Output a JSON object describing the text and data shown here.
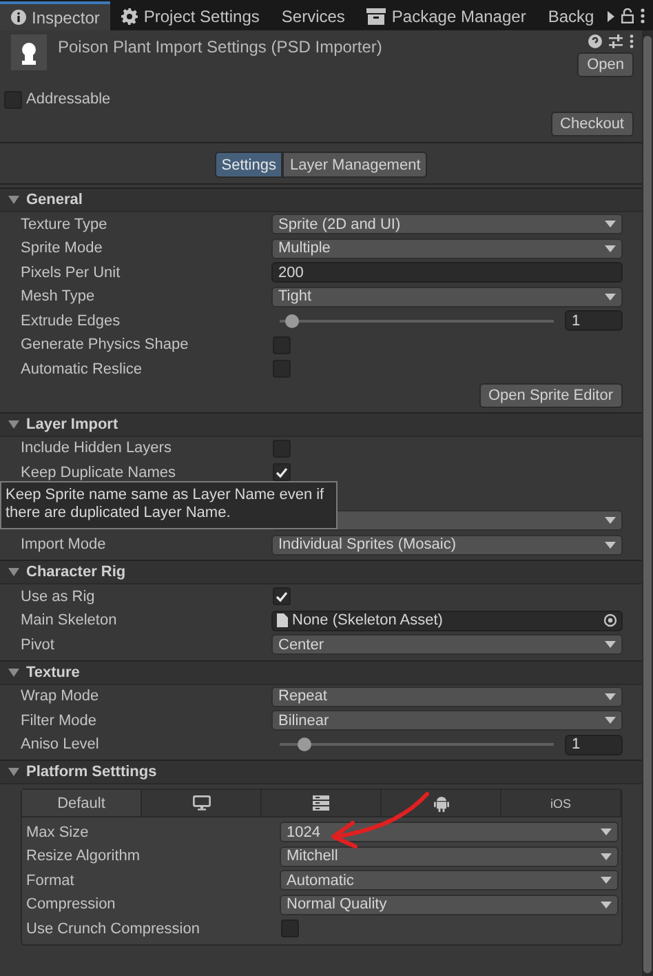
{
  "window_tabs": [
    {
      "label": "Inspector",
      "selected": true
    },
    {
      "label": "Project Settings",
      "selected": false
    },
    {
      "label": "Services",
      "selected": false
    },
    {
      "label": "Package Manager",
      "selected": false
    },
    {
      "label": "Backg",
      "selected": false
    }
  ],
  "header": {
    "title": "Poison Plant Import Settings (PSD Importer)",
    "open_button": "Open",
    "addressable": {
      "label": "Addressable",
      "checked": false
    },
    "checkout_button": "Checkout"
  },
  "mode_tabs": [
    {
      "label": "Settings",
      "selected": true
    },
    {
      "label": "Layer Management",
      "selected": false
    }
  ],
  "sections": [
    {
      "title": "General",
      "expanded": true,
      "rows": [
        {
          "kind": "dropdown",
          "label": "Texture Type",
          "value": "Sprite (2D and UI)"
        },
        {
          "kind": "dropdown",
          "label": "Sprite Mode",
          "value": "Multiple"
        },
        {
          "kind": "text",
          "label": "Pixels Per Unit",
          "value": "200"
        },
        {
          "kind": "dropdown",
          "label": "Mesh Type",
          "value": "Tight"
        },
        {
          "kind": "slider",
          "label": "Extrude Edges",
          "level": 0.02,
          "value": "1"
        },
        {
          "kind": "checkbox",
          "label": "Generate Physics Shape",
          "checked": false
        },
        {
          "kind": "checkbox",
          "label": "Automatic Reslice",
          "checked": false
        }
      ],
      "button": "Open Sprite Editor"
    },
    {
      "title": "Layer Import",
      "expanded": true,
      "tooltip": "Keep Sprite name same as Layer Name even if there are duplicated Layer Name.",
      "rows": [
        {
          "kind": "checkbox",
          "label": "Include Hidden Layers",
          "checked": false
        },
        {
          "kind": "checkbox",
          "label": "Keep Duplicate Names",
          "checked": true
        },
        {
          "kind": "covered"
        },
        {
          "kind": "dropdown"
        },
        {
          "kind": "dropdown",
          "label": "Import Mode",
          "value": "Individual Sprites (Mosaic)"
        }
      ]
    },
    {
      "title": "Character Rig",
      "expanded": true,
      "rows": [
        {
          "kind": "checkbox",
          "label": "Use as Rig",
          "checked": true
        },
        {
          "kind": "object",
          "label": "Main Skeleton",
          "value": "None (Skeleton Asset)"
        },
        {
          "kind": "dropdown",
          "label": "Pivot",
          "value": "Center"
        }
      ]
    },
    {
      "title": "Texture",
      "expanded": true,
      "rows": [
        {
          "kind": "dropdown",
          "label": "Wrap Mode",
          "value": "Repeat"
        },
        {
          "kind": "dropdown",
          "label": "Filter Mode",
          "value": "Bilinear"
        },
        {
          "kind": "slider",
          "label": "Aniso Level",
          "level": 0.07,
          "value": "1"
        }
      ]
    },
    {
      "title": "Platform Setttings",
      "expanded": true,
      "platform": {
        "tabs": [
          {
            "kind": "text",
            "label": "Default",
            "selected": true
          },
          {
            "kind": "monitor",
            "selected": false
          },
          {
            "kind": "server",
            "selected": false
          },
          {
            "kind": "android",
            "selected": false
          },
          {
            "kind": "text",
            "label": "iOS",
            "selected": false
          }
        ],
        "rows": [
          {
            "kind": "dropdown",
            "label": "Max Size",
            "value": "1024"
          },
          {
            "kind": "dropdown",
            "label": "Resize Algorithm",
            "value": "Mitchell"
          },
          {
            "kind": "dropdown",
            "label": "Format",
            "value": "Automatic"
          },
          {
            "kind": "dropdown",
            "label": "Compression",
            "value": "Normal Quality"
          },
          {
            "kind": "checkbox",
            "label": "Use Crunch Compression",
            "checked": false
          }
        ]
      }
    }
  ]
}
